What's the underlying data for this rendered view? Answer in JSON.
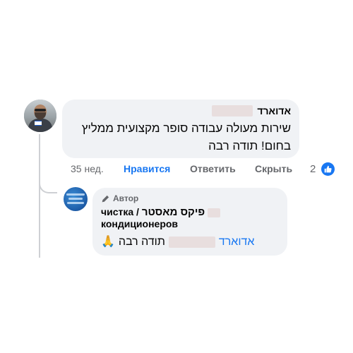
{
  "comment": {
    "author": "אדוארד",
    "text_line1": "שירות מעולה עבודה סופר מקצועית ממליץ",
    "text_line2": "בחום! תודה רבה"
  },
  "actions": {
    "time": "35 нед.",
    "like": "Нравится",
    "reply": "Ответить",
    "hide": "Скрыть",
    "reaction_count": "2"
  },
  "reply": {
    "badge": "Автор",
    "name_prefix": "чистка /",
    "name_hebrew": "פיקס מאסטר",
    "name_suffix": "кондиционеров",
    "mention": "אדוארד",
    "text": "תודה רבה",
    "emoji": "🙏"
  },
  "icons": {
    "like": "thumbs-up-icon",
    "author_badge": "pencil-icon"
  },
  "colors": {
    "accent": "#1877f2",
    "bubble": "#f0f2f5",
    "muted": "#65676b"
  }
}
